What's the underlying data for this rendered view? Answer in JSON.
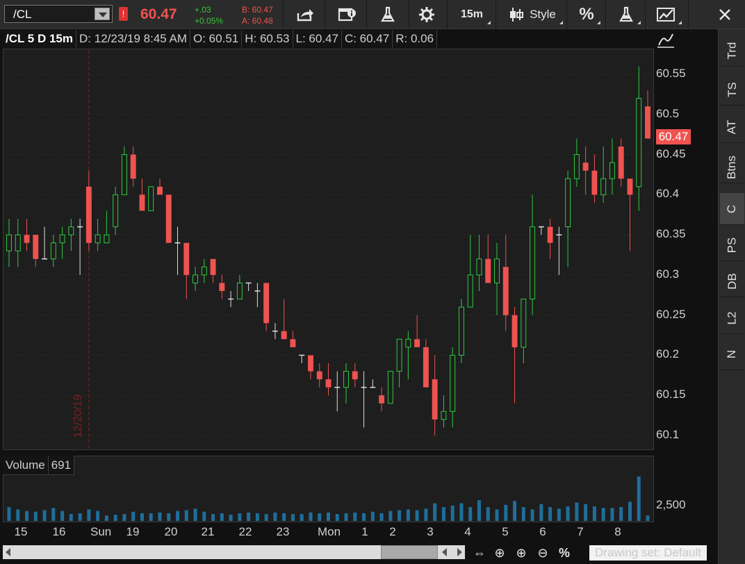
{
  "toolbar": {
    "symbol": "/CL",
    "alert_badge": "!",
    "last": "60.47",
    "change": "+.03",
    "change_pct": "+0.05%",
    "bid": "B: 60.47",
    "ask": "A: 60.48",
    "interval": "15m",
    "style_label": "Style",
    "percent_label": "%"
  },
  "header": {
    "symbol_period": "/CL 5 D 15m",
    "date": "D: 12/23/19 8:45 AM",
    "open": "O: 60.51",
    "high": "H: 60.53",
    "low": "L: 60.47",
    "close": "C: 60.47",
    "range": "R: 0.06"
  },
  "price_axis": {
    "ticks": [
      "60.55",
      "60.5",
      "60.45",
      "60.4",
      "60.35",
      "60.3",
      "60.25",
      "60.2",
      "60.15",
      "60.1"
    ],
    "last_tag": "60.47"
  },
  "session_marker": "12/20/19",
  "volume": {
    "label": "Volume",
    "value": "691",
    "tick": "2,500"
  },
  "time_axis": [
    "15",
    "16",
    "Sun",
    "19",
    "20",
    "21",
    "22",
    "23",
    "Mon",
    "1",
    "2",
    "3",
    "4",
    "5",
    "6",
    "7",
    "8"
  ],
  "sidebar": [
    "Trd",
    "TS",
    "AT",
    "Btns",
    "C",
    "PS",
    "DB",
    "L2",
    "N"
  ],
  "bottom": {
    "drawing_set": "Drawing set: Default"
  },
  "colors": {
    "up": "#2ecc40",
    "down": "#ef5350",
    "volume": "#1f6e9b",
    "background": "#1e1e1e"
  },
  "chart_data": {
    "type": "candlestick",
    "ylim": [
      60.09,
      60.57
    ],
    "candles": [
      {
        "o": 60.33,
        "h": 60.37,
        "l": 60.31,
        "c": 60.35
      },
      {
        "o": 60.33,
        "h": 60.37,
        "l": 60.31,
        "c": 60.35
      },
      {
        "o": 60.35,
        "h": 60.37,
        "l": 60.33,
        "c": 60.34
      },
      {
        "o": 60.35,
        "h": 60.35,
        "l": 60.31,
        "c": 60.32
      },
      {
        "o": 60.32,
        "h": 60.36,
        "l": 60.32,
        "c": 60.32
      },
      {
        "o": 60.32,
        "h": 60.35,
        "l": 60.31,
        "c": 60.34
      },
      {
        "o": 60.34,
        "h": 60.36,
        "l": 60.32,
        "c": 60.35
      },
      {
        "o": 60.35,
        "h": 60.37,
        "l": 60.33,
        "c": 60.36
      },
      {
        "o": 60.36,
        "h": 60.37,
        "l": 60.3,
        "c": 60.36
      },
      {
        "o": 60.41,
        "h": 60.43,
        "l": 60.33,
        "c": 60.34
      },
      {
        "o": 60.34,
        "h": 60.37,
        "l": 60.33,
        "c": 60.35
      },
      {
        "o": 60.34,
        "h": 60.38,
        "l": 60.34,
        "c": 60.35
      },
      {
        "o": 60.36,
        "h": 60.41,
        "l": 60.35,
        "c": 60.4
      },
      {
        "o": 60.4,
        "h": 60.46,
        "l": 60.4,
        "c": 60.45
      },
      {
        "o": 60.45,
        "h": 60.46,
        "l": 60.41,
        "c": 60.42
      },
      {
        "o": 60.4,
        "h": 60.42,
        "l": 60.38,
        "c": 60.38
      },
      {
        "o": 60.38,
        "h": 60.41,
        "l": 60.38,
        "c": 60.41
      },
      {
        "o": 60.41,
        "h": 60.42,
        "l": 60.4,
        "c": 60.4
      },
      {
        "o": 60.4,
        "h": 60.4,
        "l": 60.34,
        "c": 60.34
      },
      {
        "o": 60.34,
        "h": 60.36,
        "l": 60.3,
        "c": 60.34
      },
      {
        "o": 60.34,
        "h": 60.34,
        "l": 60.27,
        "c": 60.3
      },
      {
        "o": 60.29,
        "h": 60.31,
        "l": 60.28,
        "c": 60.3
      },
      {
        "o": 60.3,
        "h": 60.32,
        "l": 60.29,
        "c": 60.31
      },
      {
        "o": 60.32,
        "h": 60.32,
        "l": 60.29,
        "c": 60.3
      },
      {
        "o": 60.29,
        "h": 60.3,
        "l": 60.27,
        "c": 60.28
      },
      {
        "o": 60.27,
        "h": 60.28,
        "l": 60.26,
        "c": 60.27
      },
      {
        "o": 60.27,
        "h": 60.3,
        "l": 60.27,
        "c": 60.29
      },
      {
        "o": 60.29,
        "h": 60.29,
        "l": 60.28,
        "c": 60.29
      },
      {
        "o": 60.28,
        "h": 60.29,
        "l": 60.26,
        "c": 60.28
      },
      {
        "o": 60.29,
        "h": 60.29,
        "l": 60.23,
        "c": 60.24
      },
      {
        "o": 60.23,
        "h": 60.24,
        "l": 60.22,
        "c": 60.23
      },
      {
        "o": 60.23,
        "h": 60.27,
        "l": 60.22,
        "c": 60.22
      },
      {
        "o": 60.22,
        "h": 60.23,
        "l": 60.21,
        "c": 60.21
      },
      {
        "o": 60.2,
        "h": 60.2,
        "l": 60.19,
        "c": 60.2
      },
      {
        "o": 60.2,
        "h": 60.2,
        "l": 60.17,
        "c": 60.18
      },
      {
        "o": 60.18,
        "h": 60.19,
        "l": 60.16,
        "c": 60.17
      },
      {
        "o": 60.17,
        "h": 60.19,
        "l": 60.15,
        "c": 60.16
      },
      {
        "o": 60.16,
        "h": 60.18,
        "l": 60.13,
        "c": 60.16
      },
      {
        "o": 60.16,
        "h": 60.19,
        "l": 60.14,
        "c": 60.18
      },
      {
        "o": 60.18,
        "h": 60.19,
        "l": 60.16,
        "c": 60.17
      },
      {
        "o": 60.16,
        "h": 60.18,
        "l": 60.11,
        "c": 60.16
      },
      {
        "o": 60.16,
        "h": 60.17,
        "l": 60.16,
        "c": 60.16
      },
      {
        "o": 60.15,
        "h": 60.16,
        "l": 60.13,
        "c": 60.14
      },
      {
        "o": 60.14,
        "h": 60.18,
        "l": 60.14,
        "c": 60.18
      },
      {
        "o": 60.18,
        "h": 60.22,
        "l": 60.16,
        "c": 60.22
      },
      {
        "o": 60.21,
        "h": 60.23,
        "l": 60.17,
        "c": 60.22
      },
      {
        "o": 60.22,
        "h": 60.25,
        "l": 60.22,
        "c": 60.21
      },
      {
        "o": 60.21,
        "h": 60.22,
        "l": 60.16,
        "c": 60.16
      },
      {
        "o": 60.17,
        "h": 60.2,
        "l": 60.1,
        "c": 60.12
      },
      {
        "o": 60.12,
        "h": 60.15,
        "l": 60.11,
        "c": 60.13
      },
      {
        "o": 60.13,
        "h": 60.21,
        "l": 60.11,
        "c": 60.2
      },
      {
        "o": 60.2,
        "h": 60.27,
        "l": 60.19,
        "c": 60.26
      },
      {
        "o": 60.26,
        "h": 60.35,
        "l": 60.26,
        "c": 60.3
      },
      {
        "o": 60.3,
        "h": 60.35,
        "l": 60.28,
        "c": 60.32
      },
      {
        "o": 60.32,
        "h": 60.35,
        "l": 60.29,
        "c": 60.29
      },
      {
        "o": 60.29,
        "h": 60.34,
        "l": 60.25,
        "c": 60.32
      },
      {
        "o": 60.31,
        "h": 60.35,
        "l": 60.23,
        "c": 60.25
      },
      {
        "o": 60.25,
        "h": 60.26,
        "l": 60.14,
        "c": 60.21
      },
      {
        "o": 60.21,
        "h": 60.26,
        "l": 60.19,
        "c": 60.27
      },
      {
        "o": 60.27,
        "h": 60.4,
        "l": 60.25,
        "c": 60.36
      },
      {
        "o": 60.36,
        "h": 60.36,
        "l": 60.35,
        "c": 60.36
      },
      {
        "o": 60.36,
        "h": 60.37,
        "l": 60.32,
        "c": 60.34
      },
      {
        "o": 60.35,
        "h": 60.36,
        "l": 60.3,
        "c": 60.35
      },
      {
        "o": 60.36,
        "h": 60.43,
        "l": 60.31,
        "c": 60.42
      },
      {
        "o": 60.42,
        "h": 60.47,
        "l": 60.41,
        "c": 60.45
      },
      {
        "o": 60.44,
        "h": 60.46,
        "l": 60.4,
        "c": 60.43
      },
      {
        "o": 60.43,
        "h": 60.45,
        "l": 60.39,
        "c": 60.4
      },
      {
        "o": 60.4,
        "h": 60.46,
        "l": 60.39,
        "c": 60.42
      },
      {
        "o": 60.42,
        "h": 60.47,
        "l": 60.4,
        "c": 60.44
      },
      {
        "o": 60.46,
        "h": 60.47,
        "l": 60.41,
        "c": 60.42
      },
      {
        "o": 60.42,
        "h": 60.42,
        "l": 60.33,
        "c": 60.4
      },
      {
        "o": 60.41,
        "h": 60.56,
        "l": 60.38,
        "c": 60.52
      },
      {
        "o": 60.51,
        "h": 60.53,
        "l": 60.47,
        "c": 60.47
      }
    ],
    "volumes": [
      1800,
      1500,
      1300,
      1200,
      1400,
      1700,
      1300,
      900,
      1000,
      1500,
      1300,
      700,
      800,
      900,
      1200,
      1000,
      1000,
      1100,
      1000,
      1300,
      1400,
      1600,
      1200,
      900,
      1000,
      800,
      1000,
      1100,
      1000,
      900,
      1100,
      1000,
      900,
      900,
      1100,
      1000,
      1100,
      900,
      1000,
      1100,
      1000,
      1200,
      1000,
      1300,
      1400,
      1500,
      1400,
      1600,
      2300,
      1800,
      2000,
      2300,
      1800,
      2700,
      1800,
      1500,
      2100,
      2600,
      1800,
      1500,
      2200,
      1800,
      1600,
      1900,
      2400,
      2200,
      1900,
      1700,
      1700,
      1800,
      2500,
      5800,
      700
    ]
  }
}
